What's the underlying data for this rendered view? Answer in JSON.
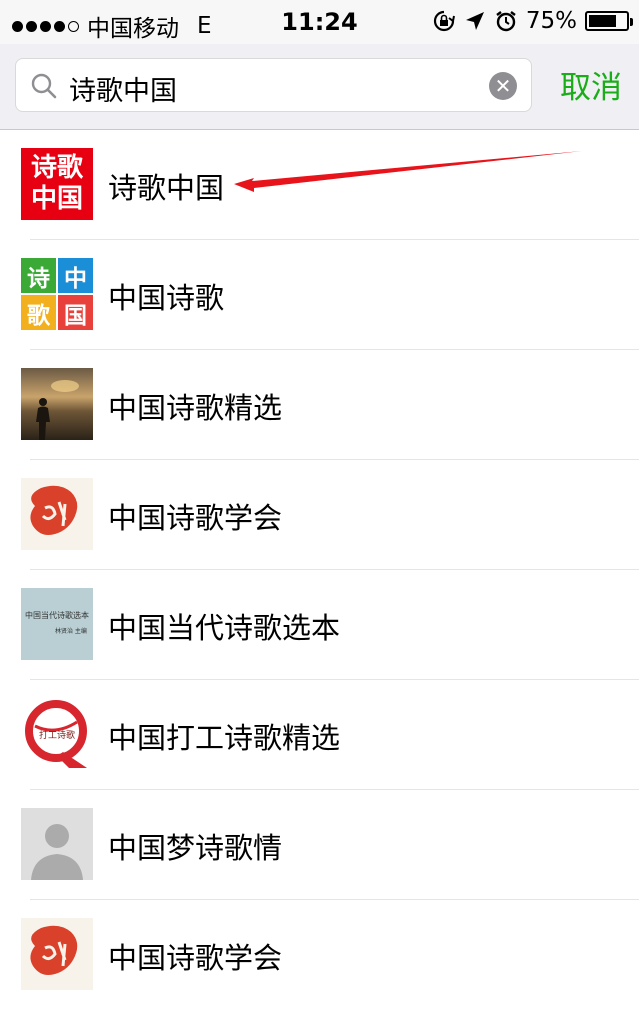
{
  "status_bar": {
    "carrier": "中国移动",
    "network": "E",
    "time": "11:24",
    "battery": "75%",
    "battery_level": 0.75
  },
  "search": {
    "query": "诗歌中国",
    "cancel_label": "取消"
  },
  "results": [
    {
      "name": "诗歌中国",
      "avatar_text": [
        "诗歌",
        "中国"
      ]
    },
    {
      "name": "中国诗歌",
      "avatar_text": [
        "诗",
        "中",
        "歌",
        "国"
      ]
    },
    {
      "name": "中国诗歌精选"
    },
    {
      "name": "中国诗歌学会"
    },
    {
      "name": "中国当代诗歌选本",
      "avatar_text": [
        "中国当代诗歌选本",
        "林贤治 主编"
      ]
    },
    {
      "name": "中国打工诗歌精选",
      "avatar_text": [
        "打工诗歌"
      ]
    },
    {
      "name": "中国梦诗歌情"
    },
    {
      "name": "中国诗歌学会"
    }
  ],
  "colors": {
    "accent": "#1aad19",
    "arrow": "#e8141b",
    "avatar_red": "#e60012",
    "grid_green": "#3aa935",
    "grid_blue": "#1a8fd8",
    "grid_yellow": "#f2b01e",
    "grid_red": "#e8413c"
  }
}
